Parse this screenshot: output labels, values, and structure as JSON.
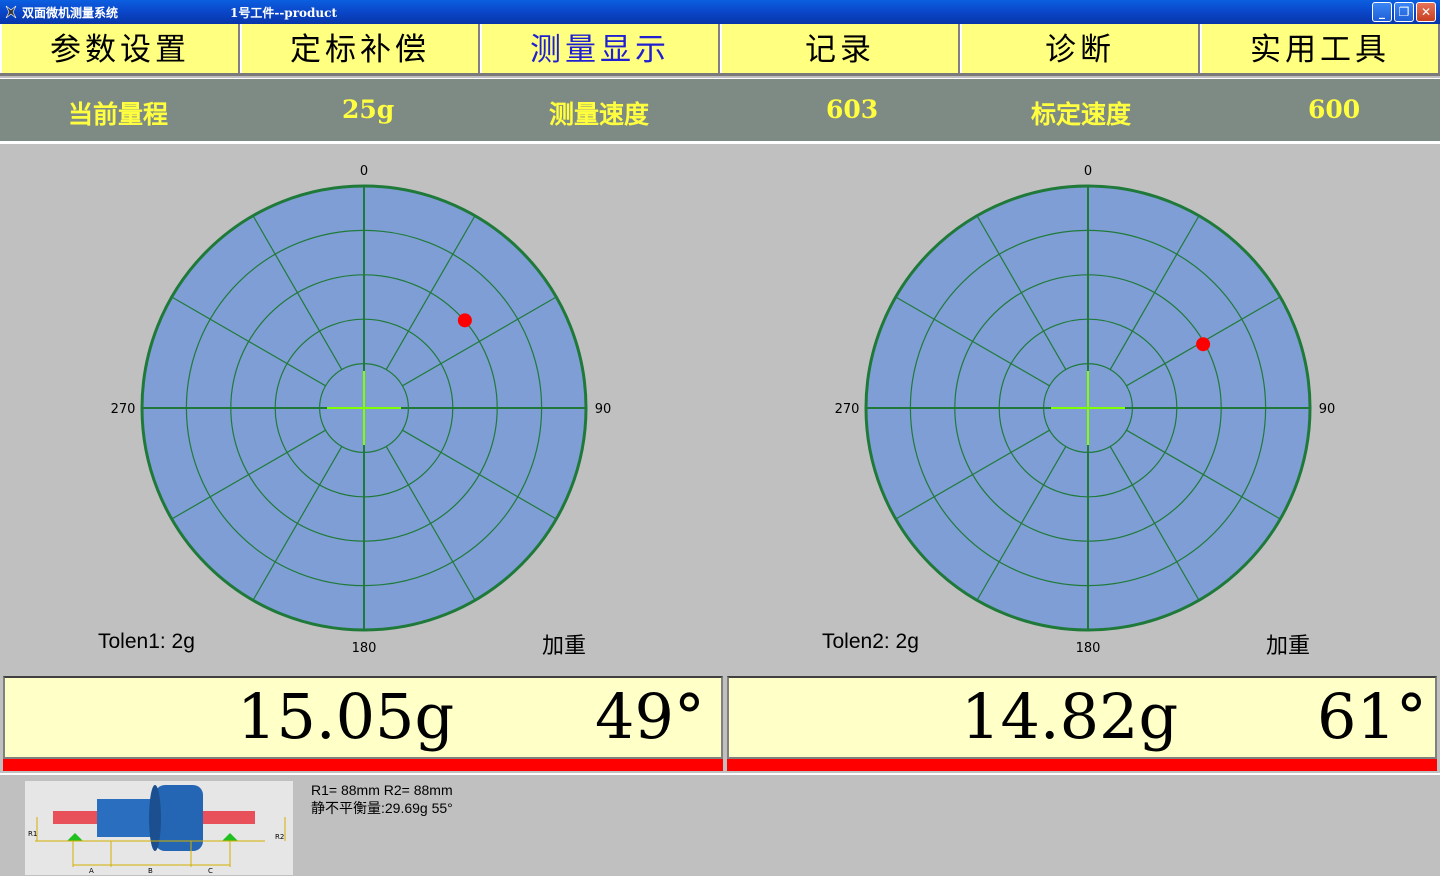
{
  "window": {
    "title": "双面微机测量系统",
    "subtitle": "1号工件--product",
    "minimize_glyph": "_",
    "restore_glyph": "❐",
    "close_glyph": "✕"
  },
  "tabs": [
    {
      "label": "参数设置"
    },
    {
      "label": "定标补偿"
    },
    {
      "label": "测量显示"
    },
    {
      "label": "记录"
    },
    {
      "label": "诊断"
    },
    {
      "label": "实用工具"
    }
  ],
  "info": {
    "range_label": "当前量程",
    "range_value": "25g",
    "meas_speed_label": "测量速度",
    "meas_speed_value": "603",
    "cal_speed_label": "标定速度",
    "cal_speed_value": "600"
  },
  "plane1": {
    "angle_labels": {
      "top": "0",
      "right": "90",
      "bottom": "180",
      "left": "270"
    },
    "tolerance": "Tolen1: 2g",
    "mode": "加重",
    "mass": "15.05g",
    "angle": "49°",
    "point_mass_g": 15.05,
    "point_angle_deg": 49,
    "max_range_g": 25
  },
  "plane2": {
    "angle_labels": {
      "top": "0",
      "right": "90",
      "bottom": "180",
      "left": "270"
    },
    "tolerance": "Tolen2: 2g",
    "mode": "加重",
    "mass": "14.82g",
    "angle": "61°",
    "point_mass_g": 14.82,
    "point_angle_deg": 61,
    "max_range_g": 25
  },
  "colors": {
    "dial_fill": "#7f9ed5",
    "dial_lines": "#1f7a3a",
    "crosshair": "#7fff00",
    "point": "#ff0000"
  },
  "bottom": {
    "radii": "R1= 88mm   R2= 88mm",
    "static": "静不平衡量:29.69g  55°",
    "diagram_labels": {
      "r1": "R1",
      "r2": "R2",
      "a": "A",
      "b": "B",
      "c": "C"
    }
  }
}
